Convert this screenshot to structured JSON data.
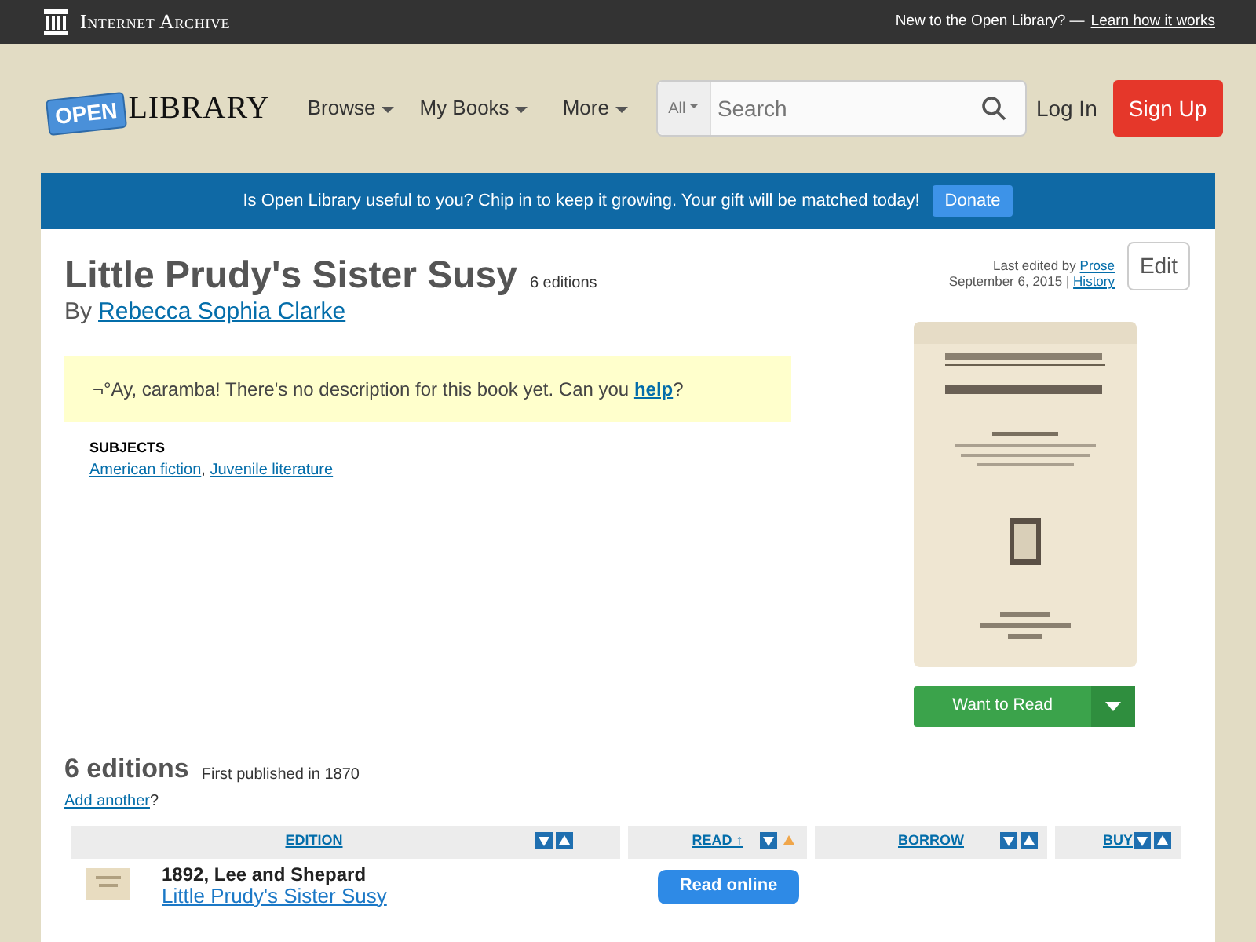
{
  "top_bar": {
    "brand": "Internet Archive",
    "prompt": "New to the Open Library? —",
    "link": "Learn how it works"
  },
  "header": {
    "logo_badge": "OPEN",
    "logo_text": "LIBRARY",
    "menus": [
      {
        "label": "Browse"
      },
      {
        "label": "My Books"
      },
      {
        "label": "More"
      }
    ],
    "search": {
      "scope": "All",
      "placeholder": "Search"
    },
    "login": "Log In",
    "signup": "Sign Up"
  },
  "banner": {
    "message": "Is Open Library useful to you? Chip in to keep it growing. Your gift will be matched today!",
    "button": "Donate"
  },
  "work": {
    "title": "Little Prudy's Sister Susy",
    "editions_count": "6 editions",
    "by": "By",
    "author": "Rebecca Sophia Clarke",
    "edit_info": {
      "prefix": "Last edited by",
      "user": "Prose",
      "date": "September 6, 2015 |",
      "history": "History"
    },
    "edit_button": "Edit",
    "description_note": {
      "before": "¬°Ay, caramba! There's no description for this book yet. Can you",
      "link": "help",
      "after": "?"
    },
    "subjects": {
      "heading": "SUBJECTS",
      "items": [
        {
          "label": "American fiction",
          "sep": ","
        },
        {
          "label": "Juvenile literature"
        }
      ]
    },
    "want_to_read": "Want to Read"
  },
  "editions": {
    "heading": "6 editions",
    "first_published": "First published in 1870",
    "add_link": "Add another",
    "add_after": "?",
    "columns": [
      {
        "label": "EDITION",
        "sorted_ascending": false
      },
      {
        "label": "READ ↑",
        "sorted_ascending": true
      },
      {
        "label": "BORROW",
        "sorted_ascending": false
      },
      {
        "label": "BUY",
        "sorted_ascending": false
      }
    ],
    "rows": [
      {
        "edition": "1892, Lee and Shepard",
        "title": "Little Prudy's Sister Susy",
        "read_button": "Read online"
      }
    ]
  }
}
